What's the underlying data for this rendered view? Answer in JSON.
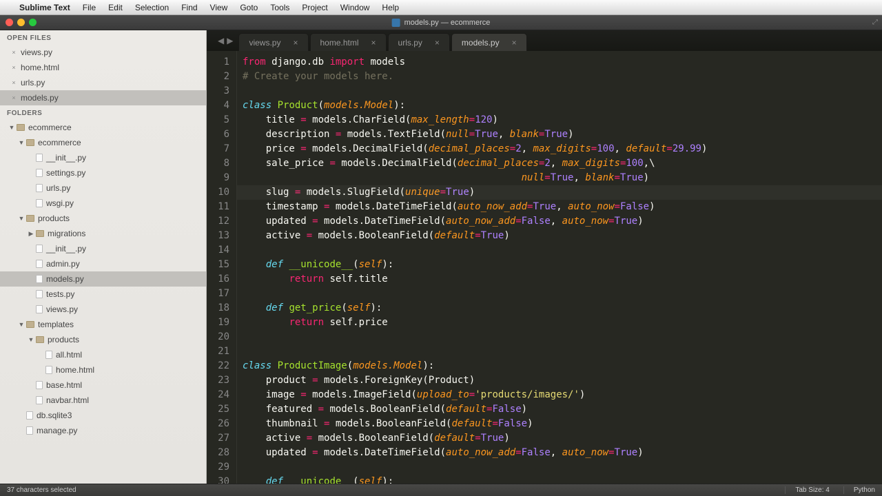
{
  "menubar": {
    "app": "Sublime Text",
    "items": [
      "File",
      "Edit",
      "Selection",
      "Find",
      "View",
      "Goto",
      "Tools",
      "Project",
      "Window",
      "Help"
    ]
  },
  "window": {
    "title": "models.py — ecommerce"
  },
  "sidebar": {
    "open_files_header": "OPEN FILES",
    "open_files": [
      "views.py",
      "home.html",
      "urls.py",
      "models.py"
    ],
    "open_active_index": 3,
    "folders_header": "FOLDERS",
    "tree": [
      {
        "depth": 0,
        "type": "folder",
        "open": true,
        "label": "ecommerce"
      },
      {
        "depth": 1,
        "type": "folder",
        "open": true,
        "label": "ecommerce"
      },
      {
        "depth": 2,
        "type": "file",
        "label": "__init__.py"
      },
      {
        "depth": 2,
        "type": "file",
        "label": "settings.py"
      },
      {
        "depth": 2,
        "type": "file",
        "label": "urls.py"
      },
      {
        "depth": 2,
        "type": "file",
        "label": "wsgi.py"
      },
      {
        "depth": 1,
        "type": "folder",
        "open": true,
        "label": "products"
      },
      {
        "depth": 2,
        "type": "folder",
        "open": false,
        "label": "migrations"
      },
      {
        "depth": 2,
        "type": "file",
        "label": "__init__.py"
      },
      {
        "depth": 2,
        "type": "file",
        "label": "admin.py"
      },
      {
        "depth": 2,
        "type": "file",
        "label": "models.py",
        "active": true
      },
      {
        "depth": 2,
        "type": "file",
        "label": "tests.py"
      },
      {
        "depth": 2,
        "type": "file",
        "label": "views.py"
      },
      {
        "depth": 1,
        "type": "folder",
        "open": true,
        "label": "templates"
      },
      {
        "depth": 2,
        "type": "folder",
        "open": true,
        "label": "products"
      },
      {
        "depth": 3,
        "type": "file",
        "label": "all.html"
      },
      {
        "depth": 3,
        "type": "file",
        "label": "home.html"
      },
      {
        "depth": 2,
        "type": "file",
        "label": "base.html"
      },
      {
        "depth": 2,
        "type": "file",
        "label": "navbar.html"
      },
      {
        "depth": 1,
        "type": "file",
        "label": "db.sqlite3"
      },
      {
        "depth": 1,
        "type": "file",
        "label": "manage.py"
      }
    ]
  },
  "tabs": {
    "items": [
      "views.py",
      "home.html",
      "urls.py",
      "models.py"
    ],
    "active_index": 3
  },
  "code": {
    "first_line": 1,
    "highlight_line": 10,
    "lines": [
      [
        [
          "kw2",
          "from"
        ],
        [
          "",
          " django.db "
        ],
        [
          "kw2",
          "import"
        ],
        [
          "",
          " models"
        ]
      ],
      [
        [
          "cm",
          "# Create your models here."
        ]
      ],
      [
        [
          "",
          ""
        ]
      ],
      [
        [
          "kw",
          "class"
        ],
        [
          "",
          " "
        ],
        [
          "cls",
          "Product"
        ],
        [
          "",
          "("
        ],
        [
          "arg",
          "models.Model"
        ],
        [
          "",
          "):"
        ]
      ],
      [
        [
          "",
          "    title "
        ],
        [
          "op",
          "="
        ],
        [
          "",
          " models.CharField("
        ],
        [
          "arg",
          "max_length"
        ],
        [
          "op",
          "="
        ],
        [
          "num",
          "120"
        ],
        [
          "",
          ")"
        ]
      ],
      [
        [
          "",
          "    description "
        ],
        [
          "op",
          "="
        ],
        [
          "",
          " models.TextField("
        ],
        [
          "arg",
          "null"
        ],
        [
          "op",
          "="
        ],
        [
          "num",
          "True"
        ],
        [
          "",
          ", "
        ],
        [
          "arg",
          "blank"
        ],
        [
          "op",
          "="
        ],
        [
          "num",
          "True"
        ],
        [
          "",
          ")"
        ]
      ],
      [
        [
          "",
          "    price "
        ],
        [
          "op",
          "="
        ],
        [
          "",
          " models.DecimalField("
        ],
        [
          "arg",
          "decimal_places"
        ],
        [
          "op",
          "="
        ],
        [
          "num",
          "2"
        ],
        [
          "",
          ", "
        ],
        [
          "arg",
          "max_digits"
        ],
        [
          "op",
          "="
        ],
        [
          "num",
          "100"
        ],
        [
          "",
          ", "
        ],
        [
          "arg",
          "default"
        ],
        [
          "op",
          "="
        ],
        [
          "num",
          "29.99"
        ],
        [
          "",
          ")"
        ]
      ],
      [
        [
          "",
          "    sale_price "
        ],
        [
          "op",
          "="
        ],
        [
          "",
          " models.DecimalField("
        ],
        [
          "arg",
          "decimal_places"
        ],
        [
          "op",
          "="
        ],
        [
          "num",
          "2"
        ],
        [
          "",
          ", "
        ],
        [
          "arg",
          "max_digits"
        ],
        [
          "op",
          "="
        ],
        [
          "num",
          "100"
        ],
        [
          "",
          ",\\"
        ]
      ],
      [
        [
          "",
          "                                                "
        ],
        [
          "arg",
          "null"
        ],
        [
          "op",
          "="
        ],
        [
          "num",
          "True"
        ],
        [
          "",
          ", "
        ],
        [
          "arg",
          "blank"
        ],
        [
          "op",
          "="
        ],
        [
          "num",
          "True"
        ],
        [
          "",
          ")"
        ]
      ],
      [
        [
          "",
          "    slug "
        ],
        [
          "op",
          "="
        ],
        [
          "",
          " models.SlugField("
        ],
        [
          "arg",
          "unique"
        ],
        [
          "op",
          "="
        ],
        [
          "num",
          "True"
        ],
        [
          "",
          ")"
        ]
      ],
      [
        [
          "",
          "    timestamp "
        ],
        [
          "op",
          "="
        ],
        [
          "",
          " models.DateTimeField("
        ],
        [
          "arg",
          "auto_now_add"
        ],
        [
          "op",
          "="
        ],
        [
          "num",
          "True"
        ],
        [
          "",
          ", "
        ],
        [
          "arg",
          "auto_now"
        ],
        [
          "op",
          "="
        ],
        [
          "num",
          "False"
        ],
        [
          "",
          ")"
        ]
      ],
      [
        [
          "",
          "    updated "
        ],
        [
          "op",
          "="
        ],
        [
          "",
          " models.DateTimeField("
        ],
        [
          "arg",
          "auto_now_add"
        ],
        [
          "op",
          "="
        ],
        [
          "num",
          "False"
        ],
        [
          "",
          ", "
        ],
        [
          "arg",
          "auto_now"
        ],
        [
          "op",
          "="
        ],
        [
          "num",
          "True"
        ],
        [
          "",
          ")"
        ]
      ],
      [
        [
          "",
          "    active "
        ],
        [
          "op",
          "="
        ],
        [
          "",
          " models.BooleanField("
        ],
        [
          "arg",
          "default"
        ],
        [
          "op",
          "="
        ],
        [
          "num",
          "True"
        ],
        [
          "",
          ")"
        ]
      ],
      [
        [
          "",
          ""
        ]
      ],
      [
        [
          "",
          "    "
        ],
        [
          "kw",
          "def"
        ],
        [
          "",
          " "
        ],
        [
          "fn",
          "__unicode__"
        ],
        [
          "",
          "("
        ],
        [
          "self",
          "self"
        ],
        [
          "",
          "):"
        ]
      ],
      [
        [
          "",
          "        "
        ],
        [
          "kw2",
          "return"
        ],
        [
          "",
          " self.title"
        ]
      ],
      [
        [
          "",
          ""
        ]
      ],
      [
        [
          "",
          "    "
        ],
        [
          "kw",
          "def"
        ],
        [
          "",
          " "
        ],
        [
          "fn",
          "get_price"
        ],
        [
          "",
          "("
        ],
        [
          "self",
          "self"
        ],
        [
          "",
          "):"
        ]
      ],
      [
        [
          "",
          "        "
        ],
        [
          "kw2",
          "return"
        ],
        [
          "",
          " self.price"
        ]
      ],
      [
        [
          "",
          ""
        ]
      ],
      [
        [
          "",
          ""
        ]
      ],
      [
        [
          "kw",
          "class"
        ],
        [
          "",
          " "
        ],
        [
          "cls",
          "ProductImage"
        ],
        [
          "",
          "("
        ],
        [
          "arg",
          "models.Model"
        ],
        [
          "",
          "):"
        ]
      ],
      [
        [
          "",
          "    product "
        ],
        [
          "op",
          "="
        ],
        [
          "",
          " models.ForeignKey(Product)"
        ]
      ],
      [
        [
          "",
          "    image "
        ],
        [
          "op",
          "="
        ],
        [
          "",
          " models.ImageField("
        ],
        [
          "arg",
          "upload_to"
        ],
        [
          "op",
          "="
        ],
        [
          "str",
          "'products/images/'"
        ],
        [
          "",
          ")"
        ]
      ],
      [
        [
          "",
          "    featured "
        ],
        [
          "op",
          "="
        ],
        [
          "",
          " models.BooleanField("
        ],
        [
          "arg",
          "default"
        ],
        [
          "op",
          "="
        ],
        [
          "num",
          "False"
        ],
        [
          "",
          ")"
        ]
      ],
      [
        [
          "",
          "    thumbnail "
        ],
        [
          "op",
          "="
        ],
        [
          "",
          " models.BooleanField("
        ],
        [
          "arg",
          "default"
        ],
        [
          "op",
          "="
        ],
        [
          "num",
          "False"
        ],
        [
          "",
          ")"
        ]
      ],
      [
        [
          "",
          "    active "
        ],
        [
          "op",
          "="
        ],
        [
          "",
          " models.BooleanField("
        ],
        [
          "arg",
          "default"
        ],
        [
          "op",
          "="
        ],
        [
          "num",
          "True"
        ],
        [
          "",
          ")"
        ]
      ],
      [
        [
          "",
          "    updated "
        ],
        [
          "op",
          "="
        ],
        [
          "",
          " models.DateTimeField("
        ],
        [
          "arg",
          "auto_now_add"
        ],
        [
          "op",
          "="
        ],
        [
          "num",
          "False"
        ],
        [
          "",
          ", "
        ],
        [
          "arg",
          "auto_now"
        ],
        [
          "op",
          "="
        ],
        [
          "num",
          "True"
        ],
        [
          "",
          ")"
        ]
      ],
      [
        [
          "",
          ""
        ]
      ],
      [
        [
          "",
          "    "
        ],
        [
          "kw",
          "def"
        ],
        [
          "",
          " "
        ],
        [
          "fn",
          "__unicode__"
        ],
        [
          "",
          "("
        ],
        [
          "self",
          "self"
        ],
        [
          "",
          "):"
        ]
      ]
    ]
  },
  "status": {
    "left": "37 characters selected",
    "tab_size": "Tab Size: 4",
    "lang": "Python"
  }
}
